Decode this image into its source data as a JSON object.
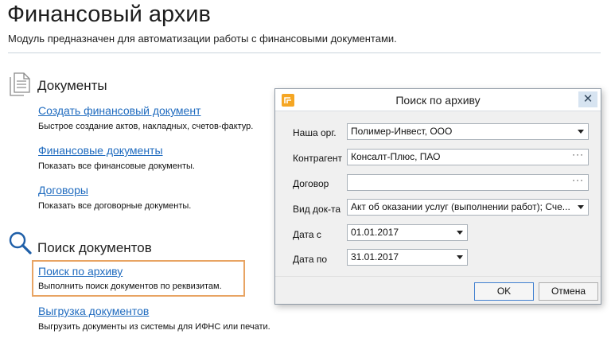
{
  "page": {
    "title": "Финансовый архив",
    "subtitle": "Модуль предназначен для автоматизации работы с финансовыми документами."
  },
  "sections": [
    {
      "title": "Документы",
      "icon": "document-icon",
      "items": [
        {
          "link": "Создать финансовый документ",
          "desc": "Быстрое создание актов, накладных, счетов-фактур."
        },
        {
          "link": "Финансовые документы",
          "desc": "Показать все финансовые документы."
        },
        {
          "link": "Договоры",
          "desc": "Показать все договорные документы."
        }
      ]
    },
    {
      "title": "Поиск документов",
      "icon": "search-icon",
      "items": [
        {
          "link": "Поиск по архиву",
          "desc": "Выполнить поиск документов по реквизитам."
        },
        {
          "link": "Выгрузка документов",
          "desc": "Выгрузить документы из системы для ИФНС или печати."
        }
      ]
    }
  ],
  "dialog": {
    "title": "Поиск по архиву",
    "close_label": "✕",
    "fields": [
      {
        "label": "Наша орг.",
        "value": "Полимер-Инвест, ООО",
        "control": "dropdown"
      },
      {
        "label": "Контрагент",
        "value": "Консалт-Плюс, ПАО",
        "control": "lookup"
      },
      {
        "label": "Договор",
        "value": "",
        "control": "lookup"
      },
      {
        "label": "Вид док-та",
        "value": "Акт об оказании услуг (выполнении работ); Сче...",
        "control": "dropdown"
      },
      {
        "label": "Дата с",
        "value": "01.01.2017",
        "control": "date"
      },
      {
        "label": "Дата по",
        "value": "31.01.2017",
        "control": "date"
      }
    ],
    "ok_label": "OK",
    "cancel_label": "Отмена",
    "colors": {
      "accent": "#f5a623",
      "link": "#1f6bbf",
      "highlight": "#e8a463"
    }
  }
}
